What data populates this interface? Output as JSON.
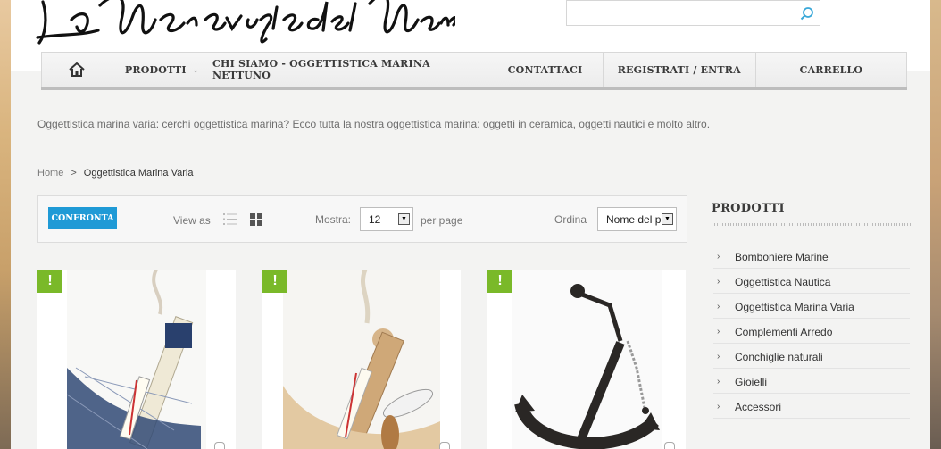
{
  "search": {
    "placeholder": ""
  },
  "nav": {
    "items": [
      {
        "label": "PRODOTTI",
        "icon": "chevron-down-icon"
      },
      {
        "label": "CHI SIAMO - OGGETTISTICA MARINA NETTUNO"
      },
      {
        "label": "CONTATTACI"
      },
      {
        "label": "REGISTRATI / ENTRA"
      },
      {
        "label": "CARRELLO"
      }
    ]
  },
  "intro": "Oggettistica marina varia: cerchi oggettistica marina? Ecco tutta la nostra oggettistica marina: oggetti in ceramica, oggetti nautici e molto altro.",
  "breadcrumb": {
    "home": "Home",
    "separator": ">",
    "current": "Oggettistica Marina Varia"
  },
  "toolbar": {
    "compare_label": "CONFRONTA",
    "view_as": "View as",
    "show_label": "Mostra:",
    "show_value": "12",
    "per_page": "per page",
    "sort_label": "Ordina",
    "sort_value": "Nome del p"
  },
  "products": [
    {
      "badge": "!"
    },
    {
      "badge": "!"
    },
    {
      "badge": "!"
    }
  ],
  "sidebar": {
    "title": "PRODOTTI",
    "items": [
      {
        "label": "Bomboniere Marine"
      },
      {
        "label": "Oggettistica Nautica"
      },
      {
        "label": "Oggettistica Marina Varia"
      },
      {
        "label": "Complementi Arredo"
      },
      {
        "label": "Conchiglie naturali"
      },
      {
        "label": "Gioielli"
      },
      {
        "label": "Accessori"
      }
    ]
  },
  "colors": {
    "accent": "#1f9ad6",
    "badge": "#7ab929"
  }
}
